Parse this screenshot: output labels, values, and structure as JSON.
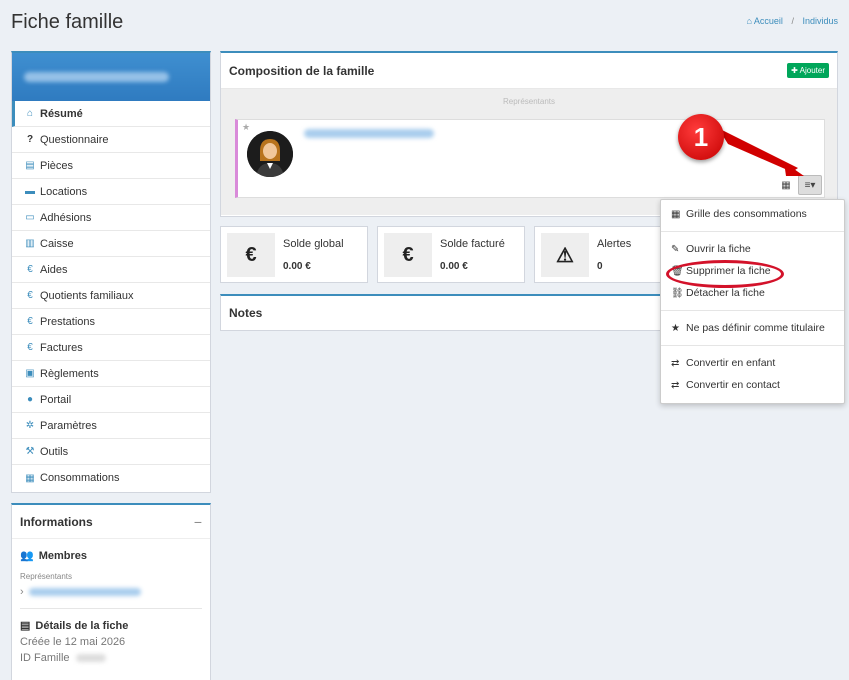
{
  "page": {
    "title": "Fiche famille",
    "breadcrumb": [
      "Accueil",
      "Individus"
    ]
  },
  "menu": {
    "items": [
      {
        "label": "Résumé",
        "icon": "home-icon"
      },
      {
        "label": "Questionnaire",
        "icon": "question-icon"
      },
      {
        "label": "Pièces",
        "icon": "file-icon"
      },
      {
        "label": "Locations",
        "icon": "cart-icon"
      },
      {
        "label": "Adhésions",
        "icon": "folder-icon"
      },
      {
        "label": "Caisse",
        "icon": "bank-icon"
      },
      {
        "label": "Aides",
        "icon": "euro-icon"
      },
      {
        "label": "Quotients familiaux",
        "icon": "euro-icon"
      },
      {
        "label": "Prestations",
        "icon": "euro-icon"
      },
      {
        "label": "Factures",
        "icon": "euro-icon"
      },
      {
        "label": "Règlements",
        "icon": "money-icon"
      },
      {
        "label": "Portail",
        "icon": "globe-icon"
      },
      {
        "label": "Paramètres",
        "icon": "gear-icon"
      },
      {
        "label": "Outils",
        "icon": "wrench-icon"
      },
      {
        "label": "Consommations",
        "icon": "calendar-icon"
      }
    ]
  },
  "info": {
    "title": "Informations",
    "members_title": "Membres",
    "representants_label": "Représentants",
    "details_title": "Détails de la fiche",
    "created": "Créée le 12 mai 2026",
    "id_label": "ID Famille"
  },
  "composition": {
    "title": "Composition de la famille",
    "add_label": "Ajouter",
    "representants_label": "Représentants"
  },
  "stats": [
    {
      "label": "Solde global",
      "value": "0.00 €",
      "icon": "€"
    },
    {
      "label": "Solde facturé",
      "value": "0.00 €",
      "icon": "€"
    },
    {
      "label": "Alertes",
      "value": "0",
      "icon": "⚠"
    }
  ],
  "notes": {
    "title": "Notes"
  },
  "dropdown": {
    "items": [
      "Grille des consommations",
      "Ouvrir la fiche",
      "Supprimer la fiche",
      "Détacher la fiche",
      "Ne pas définir comme titulaire",
      "Convertir en enfant",
      "Convertir en contact"
    ]
  },
  "callout": {
    "number": "1"
  },
  "colors": {
    "primary": "#3c8dbc",
    "success": "#00a65a",
    "annotation": "#d3122a"
  }
}
